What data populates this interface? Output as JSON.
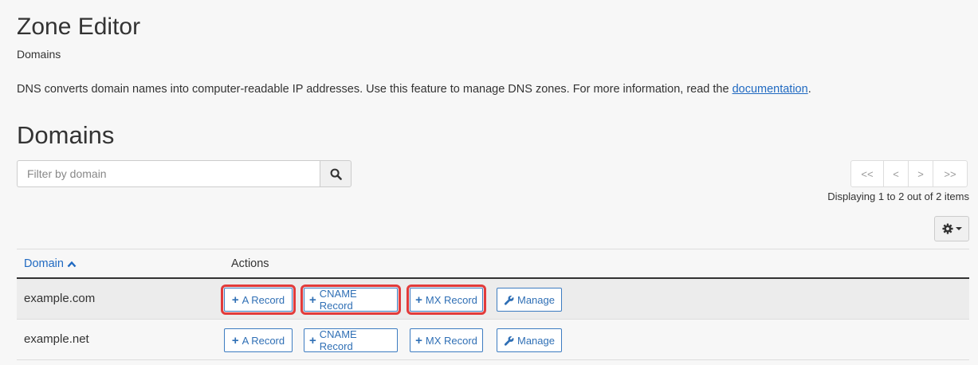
{
  "header": {
    "title": "Zone Editor",
    "breadcrumb": "Domains",
    "description": "DNS converts domain names into computer-readable IP addresses. Use this feature to manage DNS zones. For more information, read the ",
    "doc_link": "documentation",
    "description_end": "."
  },
  "section": {
    "title": "Domains"
  },
  "filter": {
    "placeholder": "Filter by domain",
    "value": ""
  },
  "pager": {
    "first": "<<",
    "prev": "<",
    "next": ">",
    "last": ">>",
    "display": "Displaying 1 to 2 out of 2 items"
  },
  "table": {
    "col_domain": "Domain",
    "col_actions": "Actions",
    "rows": [
      {
        "domain": "example.com",
        "a": "A Record",
        "cname": "CNAME Record",
        "mx": "MX Record",
        "manage": "Manage"
      },
      {
        "domain": "example.net",
        "a": "A Record",
        "cname": "CNAME Record",
        "mx": "MX Record",
        "manage": "Manage"
      }
    ]
  },
  "colors": {
    "link": "#1f69c1",
    "action_border": "#3d7cc1",
    "highlight": "#e23b3b"
  }
}
